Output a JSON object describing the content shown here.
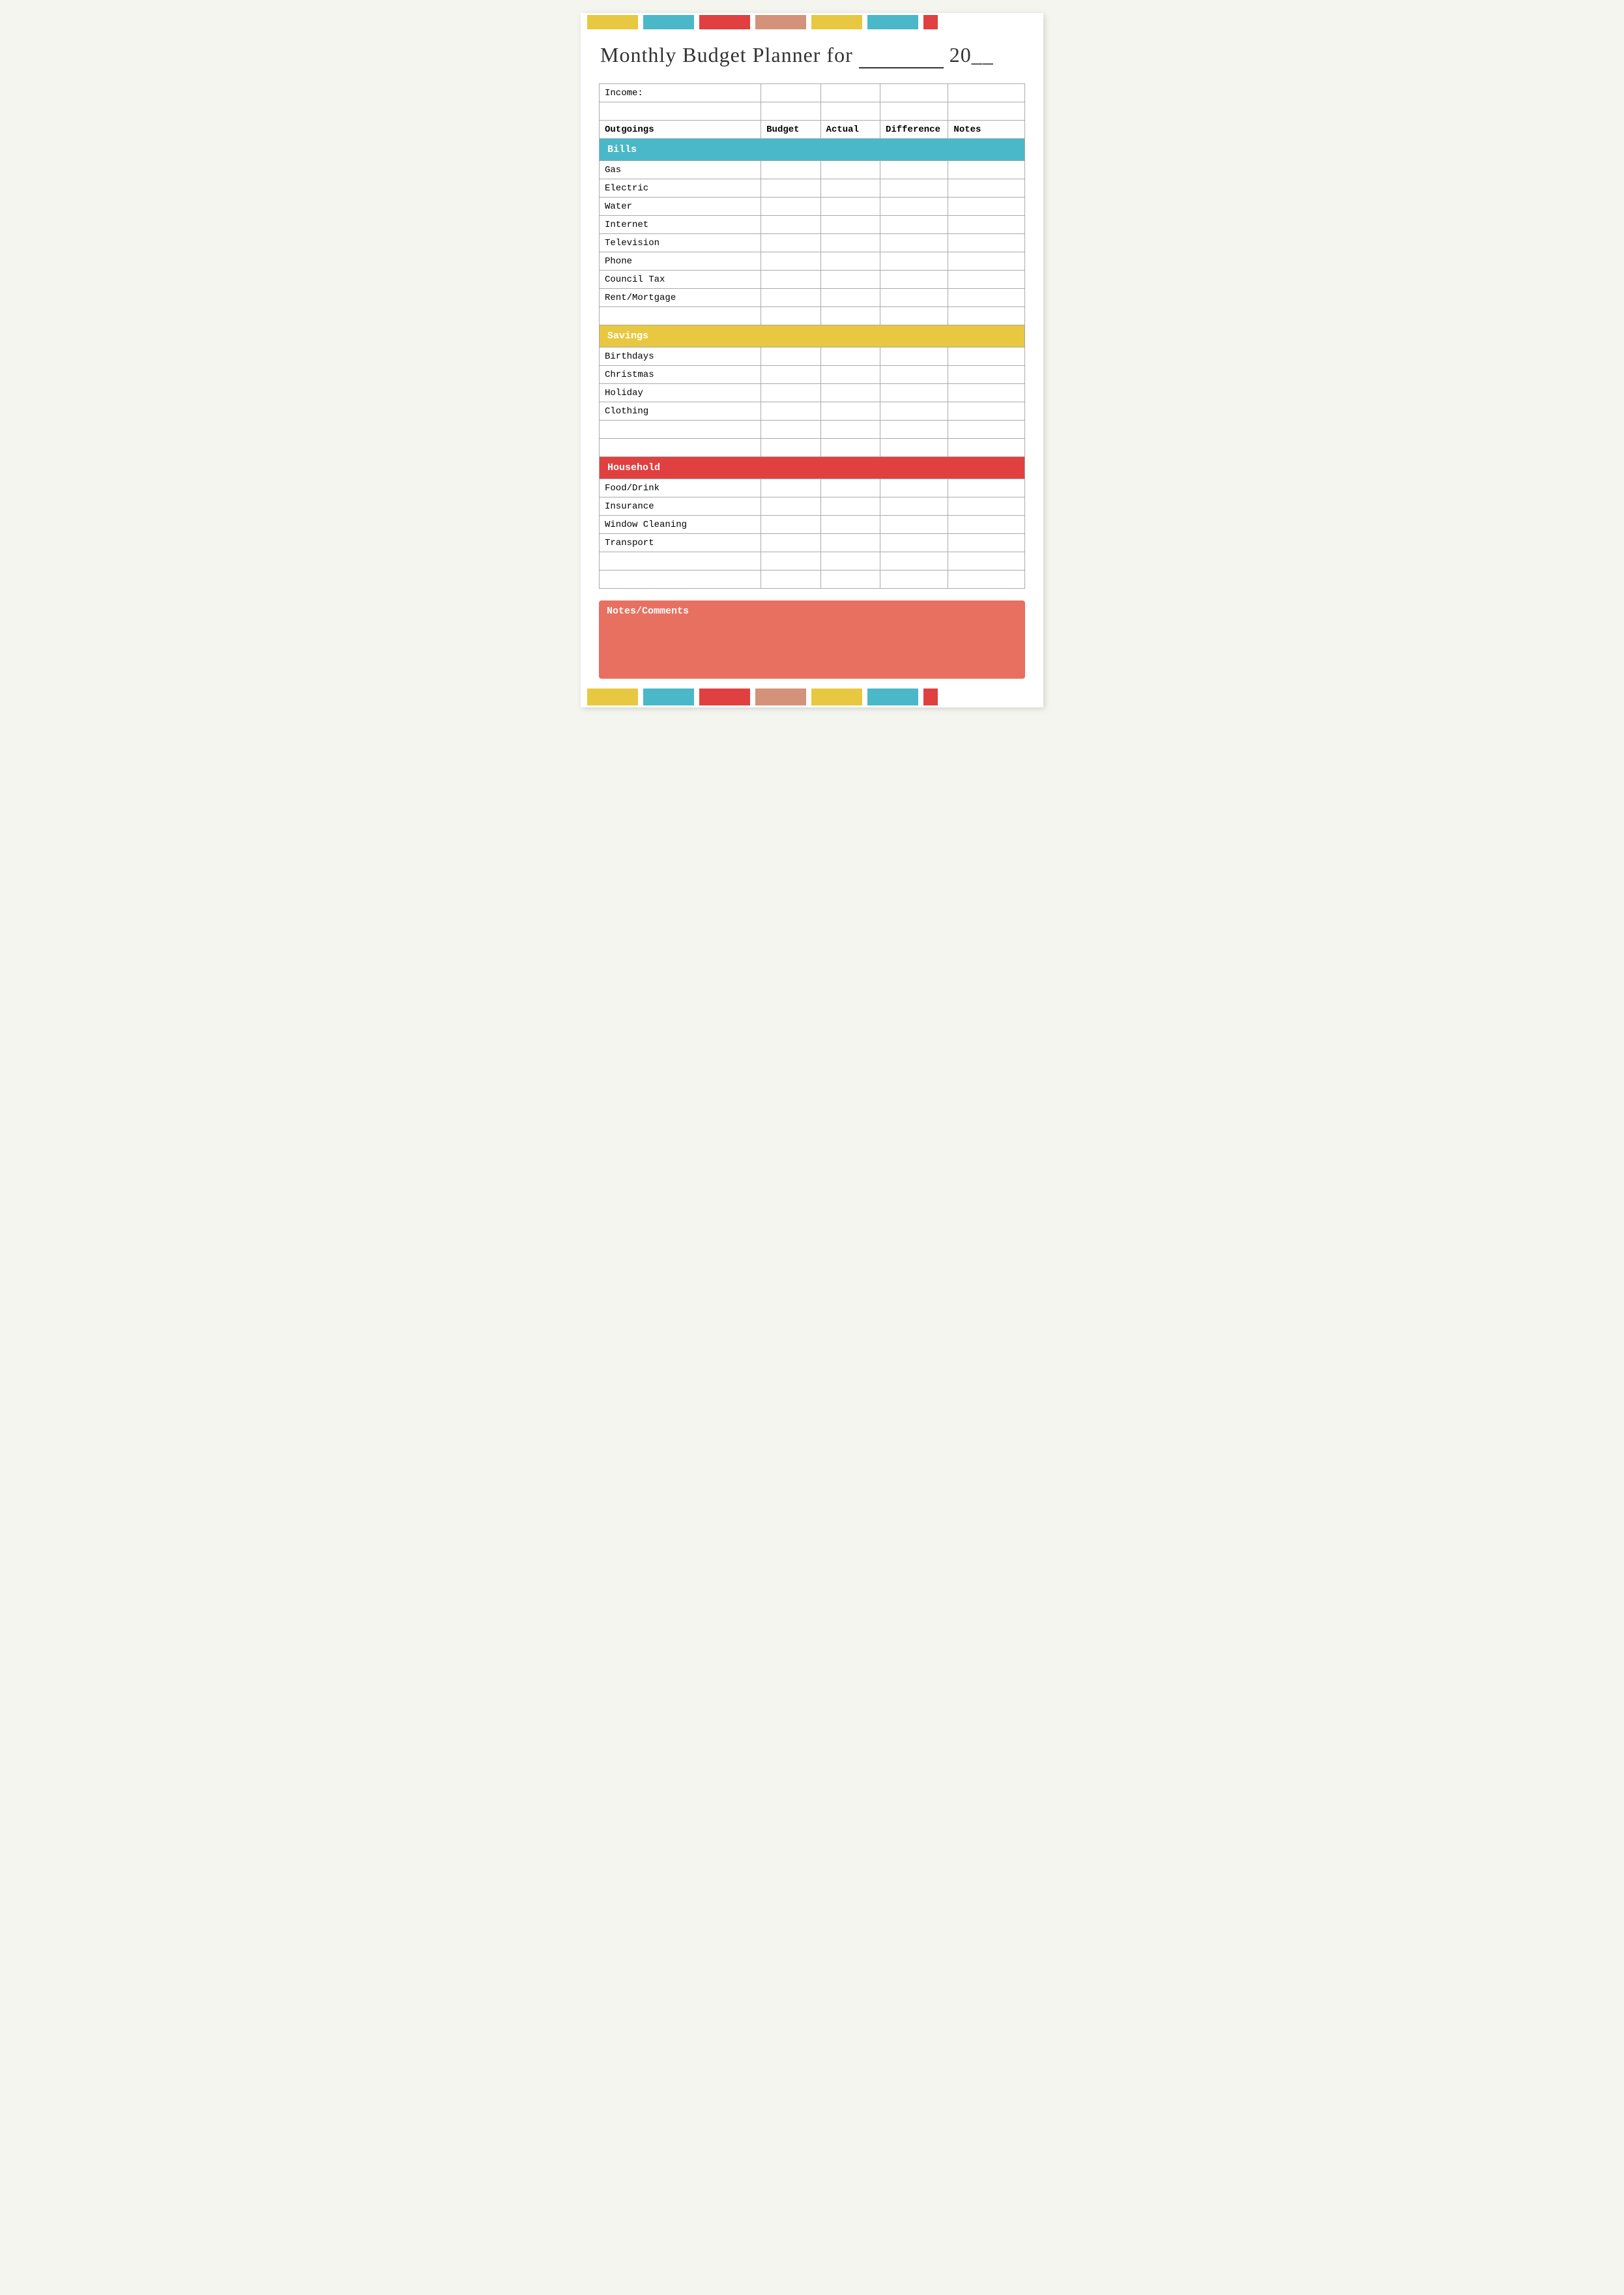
{
  "title": {
    "main": "Monthly Budget Planner for ",
    "underscore": "__________",
    "year_prefix": " 20",
    "year_suffix": "__"
  },
  "color_bar_top": [
    {
      "color": "#e8c840",
      "width": 80
    },
    {
      "color": "#ffffff",
      "width": 8
    },
    {
      "color": "#4ab8c8",
      "width": 80
    },
    {
      "color": "#ffffff",
      "width": 8
    },
    {
      "color": "#e04040",
      "width": 80
    },
    {
      "color": "#ffffff",
      "width": 8
    },
    {
      "color": "#d4927a",
      "width": 80
    },
    {
      "color": "#ffffff",
      "width": 8
    },
    {
      "color": "#e8c840",
      "width": 80
    },
    {
      "color": "#ffffff",
      "width": 8
    },
    {
      "color": "#4ab8c8",
      "width": 80
    },
    {
      "color": "#ffffff",
      "width": 8
    },
    {
      "color": "#e04040",
      "width": 20
    }
  ],
  "income_label": "Income:",
  "header": {
    "outgoings": "Outgoings",
    "budget": "Budget",
    "actual": "Actual",
    "difference": "Difference",
    "notes": "Notes"
  },
  "sections": {
    "bills": {
      "label": "Bills",
      "items": [
        "Gas",
        "Electric",
        "Water",
        "Internet",
        "Television",
        "Phone",
        "Council Tax",
        "Rent/Mortgage"
      ]
    },
    "savings": {
      "label": "Savings",
      "items": [
        "Birthdays",
        "Christmas",
        "Holiday",
        "Clothing"
      ]
    },
    "household": {
      "label": "Household",
      "items": [
        "Food/Drink",
        "Insurance",
        "Window Cleaning",
        "Transport"
      ]
    }
  },
  "notes_section": {
    "label": "Notes/Comments"
  }
}
